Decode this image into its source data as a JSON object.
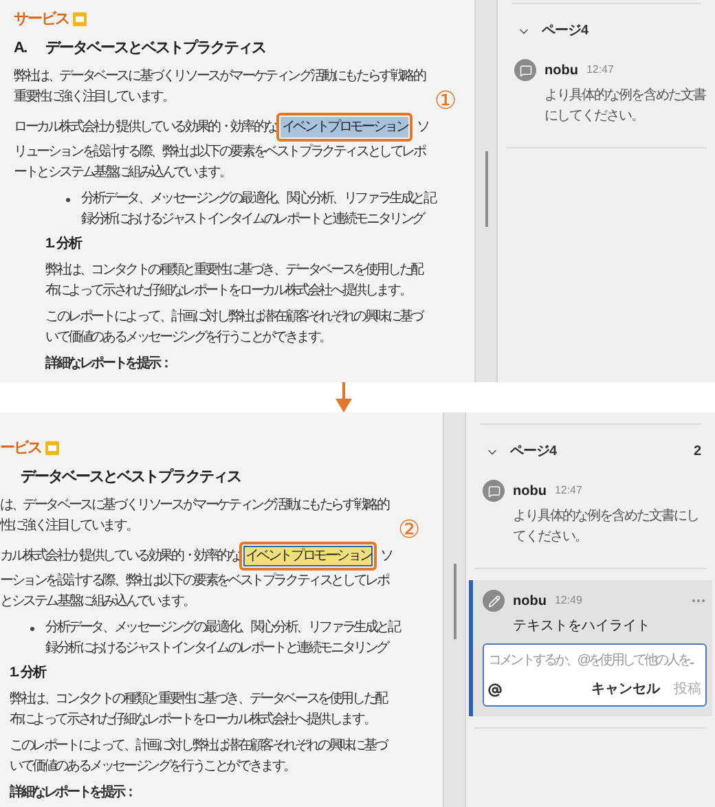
{
  "panels": [
    {
      "shifted_left": false,
      "doc": [
        {
          "kind": "heading",
          "text": "サービス"
        },
        {
          "kind": "title",
          "letter": "A.",
          "text": "データベースとベストプラクティス"
        },
        {
          "kind": "paragraph",
          "lines": [
            "弊社は、データベースに基づくリソースがマーケティング活動にもたらす戦略的",
            "重要性に強く注目しています。"
          ]
        },
        {
          "kind": "promo",
          "before": "ローカル株式会社が提供している効果的・効率的な",
          "highlight": {
            "text": "イベントプロモーション",
            "selected": true,
            "highlighted": false
          },
          "callout": "①",
          "after": "ソ",
          "lines": [
            "リューションを設計する際、弊社は以下の要素をベストプラクティスとしてレポ",
            "ートとシステム基盤に組み込んでいます。"
          ]
        },
        {
          "kind": "bullet",
          "lines": [
            "分析データ、メッセージングの最適化、関心分析、リファラ生成と記",
            "録分析におけるジャストインタイムのレポートと連続モニタリング"
          ]
        },
        {
          "kind": "section",
          "title": "1. 分析",
          "children": [
            {
              "kind": "paragraph",
              "lines": [
                "弊社は、コンタクトの種類と重要性に基づき、データベースを使用した配",
                "布によって示された仔細なレポートをローカル株式会社へ提供します。"
              ]
            },
            {
              "kind": "paragraph",
              "lines": [
                "このレポートによって、計画に対し弊社は潜在顧客それぞれの興味に基づ",
                "いて価値のあるメッセージングを行うことができます。"
              ]
            },
            {
              "kind": "bold",
              "text": "詳細なレポートを提示："
            }
          ]
        }
      ],
      "comments_panel": {
        "expanded": true,
        "page_label": "ページ4",
        "comments": [
          {
            "author": "nobu",
            "time": "12:47",
            "kind": "comment",
            "text": "より具体的な例を含めた文書にしてください。",
            "selected": false
          }
        ]
      }
    },
    {
      "shifted_left": true,
      "doc": [
        {
          "kind": "heading",
          "text": "ービス"
        },
        {
          "kind": "title",
          "text": "データベースとベストプラクティス"
        },
        {
          "kind": "paragraph",
          "lines": [
            "は、データベースに基づくリソースがマーケティング活動にもたらす戦略的",
            "性に強く注目しています。"
          ]
        },
        {
          "kind": "promo",
          "before": "カル株式会社が提供している効果的・効率的な",
          "highlight": {
            "text": "イベントプロモーション",
            "selected": true,
            "highlighted": true
          },
          "callout": "②",
          "after": "ソ",
          "lines": [
            "ーションを設計する際、弊社は以下の要素をベストプラクティスとしてレポ",
            "とシステム基盤に組み込んでいます。"
          ]
        },
        {
          "kind": "bullet",
          "lines": [
            "分析データ、メッセージングの最適化、関心分析、リファラ生成と記",
            "録分析におけるジャストインタイムのレポートと連続モニタリング"
          ]
        },
        {
          "kind": "section",
          "title": "1. 分析",
          "children": [
            {
              "kind": "paragraph",
              "lines": [
                "弊社は、コンタクトの種類と重要性に基づき、データベースを使用した配",
                "布によって示された仔細なレポートをローカル株式会社へ提供します。"
              ]
            },
            {
              "kind": "paragraph",
              "lines": [
                "このレポートによって、計画に対し弊社は潜在顧客それぞれの興味に基づ",
                "いて価値のあるメッセージングを行うことができます。"
              ]
            },
            {
              "kind": "bold",
              "text": "詳細なレポートを提示："
            }
          ]
        }
      ],
      "comments_panel": {
        "expanded": true,
        "page_label": "ページ4",
        "count": "2",
        "comments": [
          {
            "author": "nobu",
            "time": "12:47",
            "kind": "comment",
            "text": "より具体的な例を含めた文書にしてください。",
            "selected": false
          },
          {
            "author": "nobu",
            "time": "12:49",
            "kind": "highlight",
            "text": "テキストをハイライト",
            "selected": true,
            "reply": {
              "placeholder": "コメントするか、@を使用して他の人を...",
              "cancel": "キャンセル",
              "post": "投稿",
              "post_disabled": true
            }
          }
        ]
      }
    }
  ]
}
